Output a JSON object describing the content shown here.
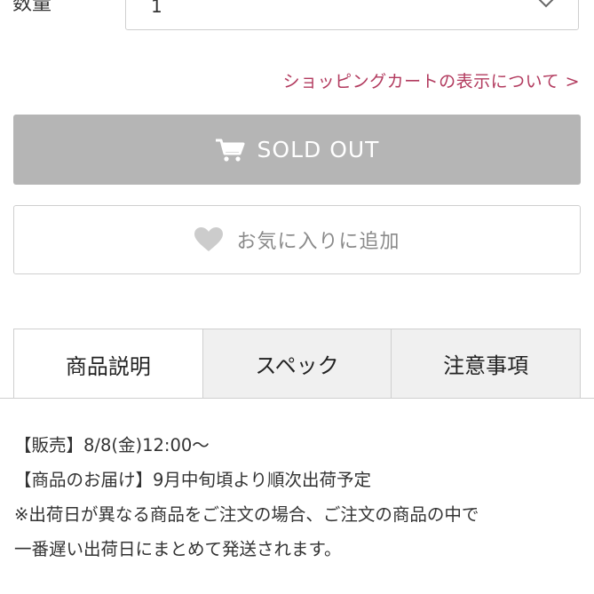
{
  "quantity": {
    "label": "数量",
    "value": "1",
    "chevron_icon": "chevron-down-icon"
  },
  "cart_info_link": "ショッピングカートの表示について >",
  "soldout_button": {
    "label": "SOLD OUT",
    "icon": "cart-icon",
    "color": "#b5b5b5"
  },
  "favorite_button": {
    "label": "お気に入りに追加",
    "icon": "heart-icon",
    "icon_color": "#cccccc"
  },
  "tabs": [
    {
      "label": "商品説明",
      "active": true
    },
    {
      "label": "スペック",
      "active": false
    },
    {
      "label": "注意事項",
      "active": false
    }
  ],
  "description": {
    "lines": [
      "【販売】8/8(金)12:00～",
      "【商品のお届け】9月中旬頃より順次出荷予定",
      "※出荷日が異なる商品をご注文の場合、ご注文の商品の中で",
      "一番遅い出荷日にまとめて発送されます。"
    ]
  },
  "colors": {
    "link": "#b23a5e",
    "border": "#cfcfcf",
    "inactive_tab_bg": "#f0f0f0"
  }
}
